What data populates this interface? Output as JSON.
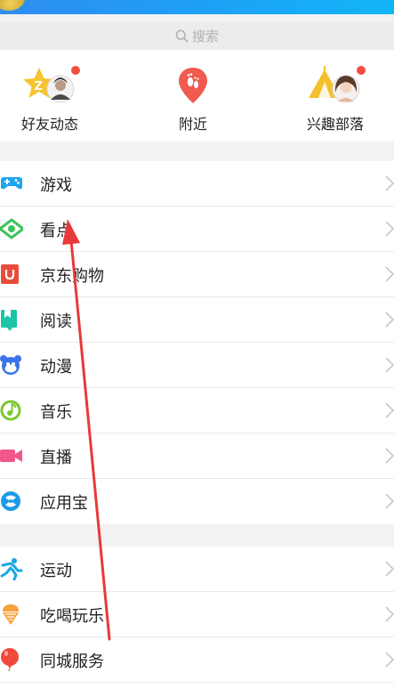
{
  "search": {
    "placeholder": "搜索",
    "icon": "search-icon"
  },
  "quick_actions": [
    {
      "label": "好友动态",
      "icon": "friends-feed-icon",
      "badge": true
    },
    {
      "label": "附近",
      "icon": "nearby-location-icon",
      "badge": false
    },
    {
      "label": "兴趣部落",
      "icon": "interest-tribe-icon",
      "badge": true
    }
  ],
  "menu_group_1": [
    {
      "label": "游戏",
      "icon": "gamepad-icon",
      "color": "#1fa5ef"
    },
    {
      "label": "看点",
      "icon": "eye-icon",
      "color": "#3cc35a"
    },
    {
      "label": "京东购物",
      "icon": "jd-shopping-icon",
      "color": "#e84d3c"
    },
    {
      "label": "阅读",
      "icon": "book-icon",
      "color": "#1bc3a7"
    },
    {
      "label": "动漫",
      "icon": "anime-icon",
      "color": "#3b73e8"
    },
    {
      "label": "音乐",
      "icon": "music-icon",
      "color": "#7bc832"
    },
    {
      "label": "直播",
      "icon": "live-video-icon",
      "color": "#f0588a"
    },
    {
      "label": "应用宝",
      "icon": "app-store-icon",
      "color": "#1b9ae8"
    }
  ],
  "menu_group_2": [
    {
      "label": "运动",
      "icon": "running-icon",
      "color": "#18a6e6"
    },
    {
      "label": "吃喝玩乐",
      "icon": "ice-cream-icon",
      "color": "#f5a23a"
    },
    {
      "label": "同城服务",
      "icon": "balloon-icon",
      "color": "#ef4a3c"
    }
  ],
  "colors": {
    "topbar": "#1ea0f5",
    "annotation_arrow": "#e8393a"
  }
}
